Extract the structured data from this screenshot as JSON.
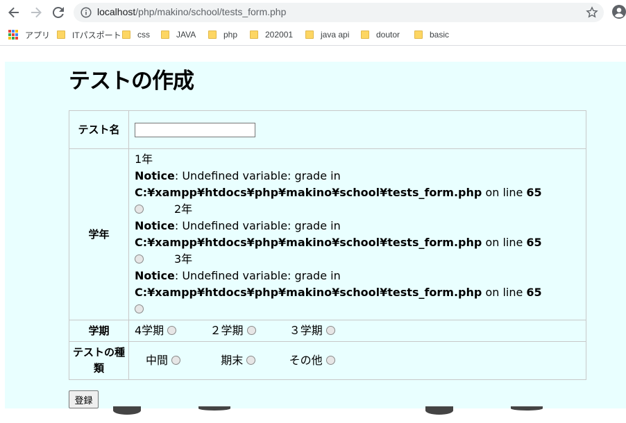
{
  "browser": {
    "url_host": "localhost",
    "url_path": "/php/makino/school/tests_form.php",
    "bookmarks": [
      "アプリ",
      "ITパスポート",
      "css",
      "JAVA",
      "php",
      "202001",
      "java api",
      "doutor",
      "basic"
    ]
  },
  "page": {
    "title": "テストの作成",
    "submit_label": "登録"
  },
  "form": {
    "name_label": "テスト名",
    "name_value": "",
    "grade_label": "学年",
    "grade_options": [
      "1年",
      "2年",
      "3年"
    ],
    "notice_word": "Notice",
    "notice_text": ": Undefined variable: grade in",
    "notice_path": "C:¥xampp¥htdocs¥php¥makino¥school¥tests_form.php",
    "notice_online": " on line ",
    "notice_lineno": "65",
    "term_label": "学期",
    "term_options": [
      "4学期",
      "２学期",
      "３学期"
    ],
    "type_label": "テストの種類",
    "type_options": [
      "中間",
      "期末",
      "その他"
    ]
  },
  "colors": {
    "page_bg": "#e9ffff",
    "table_border": "#c8c8c8"
  }
}
